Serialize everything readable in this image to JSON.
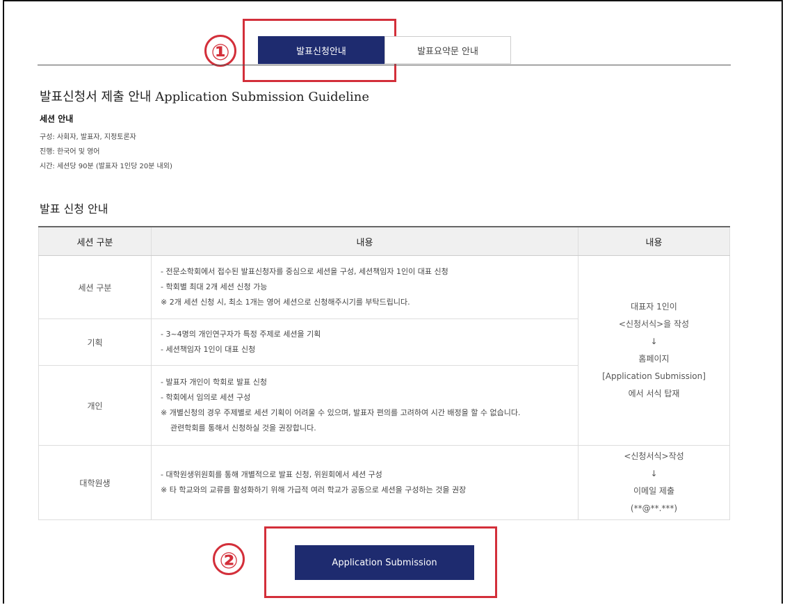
{
  "annotations": {
    "marker1": "①",
    "marker2": "②"
  },
  "tabs": [
    {
      "label": "발표신청안내",
      "active": true
    },
    {
      "label": "발표요약문 안내",
      "active": false
    }
  ],
  "page_title": "발표신청서 제출 안내 Application Submission Guideline",
  "session_info": {
    "title": "세션 안내",
    "lines": [
      "구성: 사회자, 발표자, 지정토론자",
      "진행: 한국어 및 영어",
      "시간: 세션당 90분 (발표자 1인당 20분 내외)"
    ]
  },
  "section_title": "발표 신청 안내",
  "table": {
    "headers": [
      "세션 구분",
      "내용",
      "내용"
    ],
    "rows": [
      {
        "category": "세션 구분",
        "lines": [
          "- 전문소학회에서 접수된 발표신청자를 중심으로 세션을 구성, 세션책임자 1인이 대표 신청",
          "- 학회별 최대 2개 세션 신청 가능",
          "※ 2개 세션 신청 시, 최소 1개는 영어 세션으로 신청해주시기를 부탁드립니다."
        ]
      },
      {
        "category": "기획",
        "lines": [
          "- 3~4명의 개인연구자가 특정 주제로 세션을 기획",
          "- 세션책임자 1인이 대표 신청"
        ]
      },
      {
        "category": "개인",
        "lines": [
          "- 발표자 개인이 학회로 발표 신청",
          "- 학회에서 임의로 세션 구성",
          "※ 개별신청의 경우 주제별로 세션 기획이 어려울 수 있으며, 발표자 편의를 고려하여 시간 배정을 할 수 없습니다.",
          "관련학회를 통해서 신청하실 것을 권장합니다."
        ]
      },
      {
        "category": "대학원생",
        "lines": [
          "- 대학원생위원회를 통해 개별적으로 발표 신청, 위원회에서 세션 구성",
          "※ 타 학교와의 교류를 활성화하기 위해 가급적 여러 학교가 공동으로 세션을 구성하는 것을 권장"
        ]
      }
    ],
    "side_top": [
      "대표자 1인이",
      "<신청서식>을 작성",
      "↓",
      "홈페이지",
      "[Application Submission]",
      "에서 서식 탑재"
    ],
    "side_bottom": [
      "<신청서식>작성",
      "↓",
      "이메일 제출",
      "(**@**.***)"
    ]
  },
  "submit_button": "Application Submission",
  "colors": {
    "primary": "#1e2b6f",
    "annotation": "#d32f3a"
  }
}
